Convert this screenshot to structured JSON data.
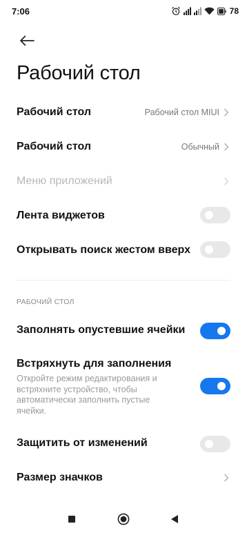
{
  "status_bar": {
    "time": "7:06",
    "battery_percent": "78",
    "icons": [
      "alarm-icon",
      "signal-icon",
      "signal-icon",
      "wifi-icon",
      "battery-icon"
    ]
  },
  "header": {
    "back_icon": "arrow-left-icon",
    "title": "Рабочий стол"
  },
  "settings": {
    "home_screen": {
      "label": "Рабочий стол",
      "value": "Рабочий стол MIUI"
    },
    "home_mode": {
      "label": "Рабочий стол",
      "value": "Обычный"
    },
    "app_drawer": {
      "label": "Меню приложений",
      "disabled": true
    },
    "widget_feed": {
      "label": "Лента виджетов",
      "enabled": false
    },
    "swipe_search": {
      "label": "Открывать поиск жестом вверх",
      "enabled": false
    }
  },
  "section": {
    "header": "РАБОЧИЙ СТОЛ",
    "fill_cells": {
      "label": "Заполнять опустевшие ячейки",
      "enabled": true
    },
    "shake_fill": {
      "label": "Встряхнуть для заполнения",
      "description": "Откройте режим редактирования и встряхните устройство, чтобы автоматически заполнить пустые ячейки.",
      "enabled": true
    },
    "lock_layout": {
      "label": "Защитить от изменений",
      "enabled": false
    },
    "icon_size": {
      "label": "Размер значков"
    }
  },
  "nav_bar": {
    "buttons": [
      "recents-square-icon",
      "home-circle-icon",
      "back-triangle-icon"
    ]
  },
  "colors": {
    "accent": "#1677ee",
    "toggle_off": "#e8e8e8",
    "background": "#ffffff"
  }
}
